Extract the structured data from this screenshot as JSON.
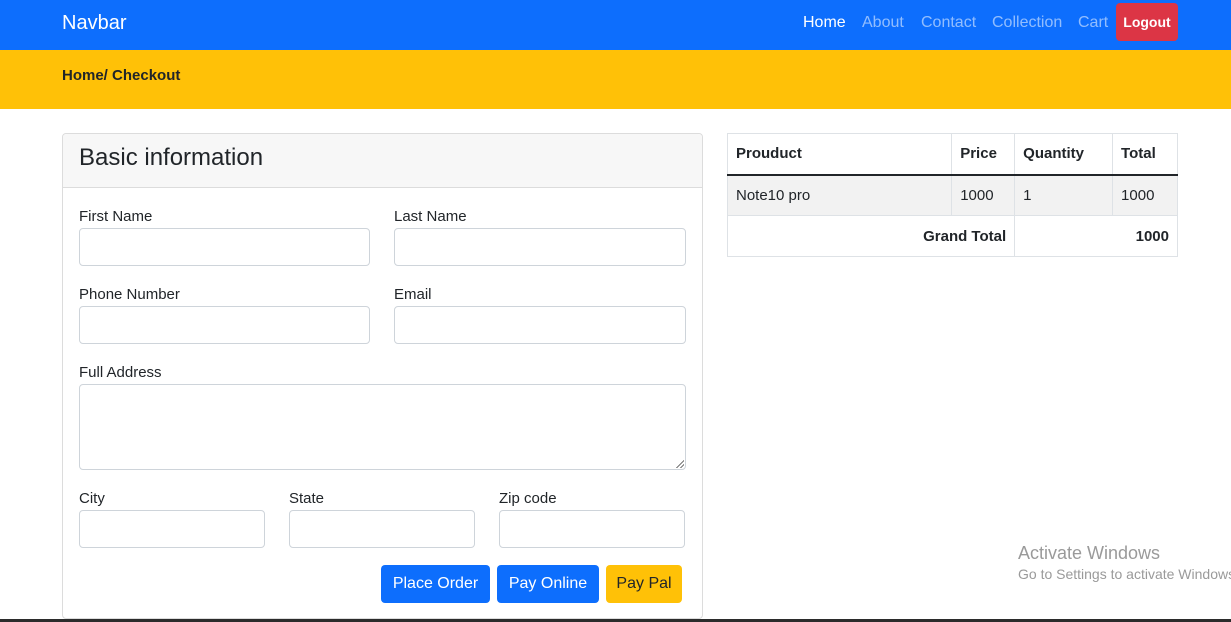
{
  "navbar": {
    "brand": "Navbar",
    "links": [
      {
        "label": "Home",
        "active": true
      },
      {
        "label": "About",
        "active": false
      },
      {
        "label": "Contact",
        "active": false
      },
      {
        "label": "Collection",
        "active": false
      },
      {
        "label": "Cart",
        "active": false
      }
    ],
    "logout_label": "Logout"
  },
  "breadcrumb": "Home/ Checkout",
  "form": {
    "title": "Basic information",
    "fields": {
      "first_name": {
        "label": "First Name",
        "value": ""
      },
      "last_name": {
        "label": "Last Name",
        "value": ""
      },
      "phone": {
        "label": "Phone Number",
        "value": ""
      },
      "email": {
        "label": "Email",
        "value": ""
      },
      "address": {
        "label": "Full Address",
        "value": ""
      },
      "city": {
        "label": "City",
        "value": ""
      },
      "state": {
        "label": "State",
        "value": ""
      },
      "zip": {
        "label": "Zip code",
        "value": ""
      }
    },
    "buttons": {
      "place_order": "Place Order",
      "pay_online": "Pay Online",
      "pay_pal": "Pay Pal"
    }
  },
  "order_summary": {
    "headers": [
      "Prouduct",
      "Price",
      "Quantity",
      "Total"
    ],
    "rows": [
      [
        "Note10 pro",
        "1000",
        "1",
        "1000"
      ]
    ],
    "grand_total_label": "Grand Total",
    "grand_total_value": "1000"
  },
  "watermark": {
    "title": "Activate Windows",
    "subtitle": "Go to Settings to activate Windows."
  },
  "colors": {
    "primary": "#0d6efd",
    "warning": "#ffc107",
    "danger": "#dc3545"
  }
}
